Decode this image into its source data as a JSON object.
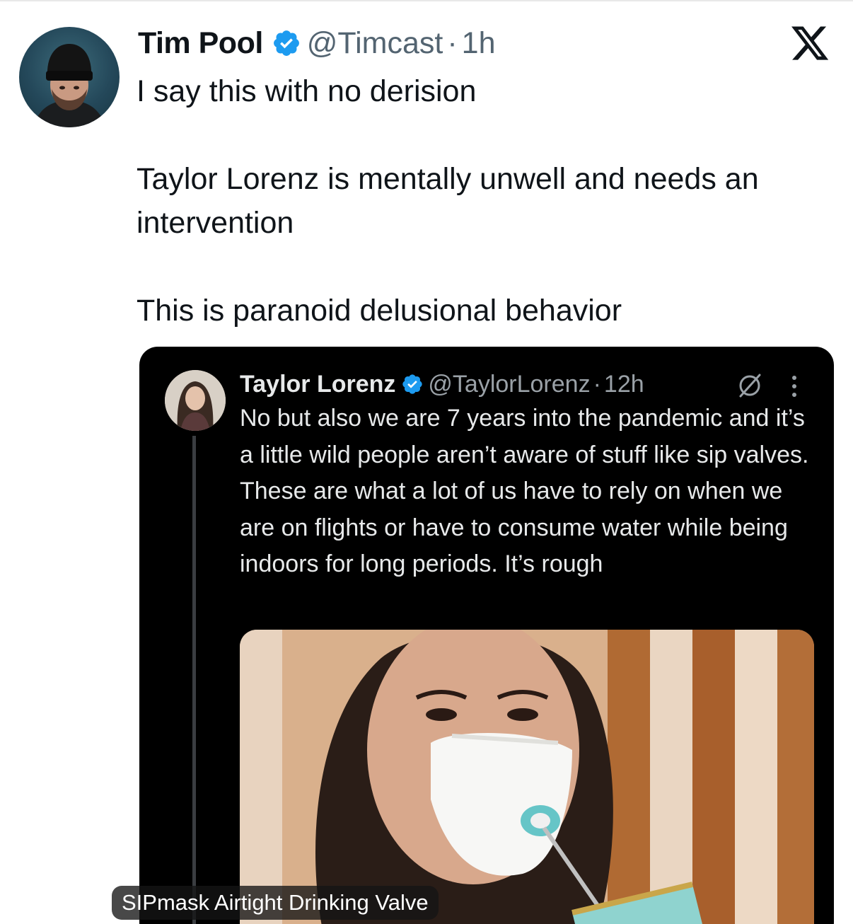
{
  "tweet": {
    "author_name": "Tim Pool",
    "handle": "@Timcast",
    "separator": "·",
    "time": "1h",
    "text_lines": [
      "I say this with no derision",
      "Taylor Lorenz is mentally unwell and needs an intervention",
      "This is paranoid delusional behavior"
    ]
  },
  "quoted": {
    "author_name": "Taylor Lorenz",
    "handle": "@TaylorLorenz",
    "separator": "·",
    "time": "12h",
    "text": "No but also we are 7 years into the pandemic and it’s a little wild people aren’t aware of stuff like sip valves. These are what a lot of us have to rely on when we are on flights or have to consume water while being indoors for long periods. It’s rough",
    "media_caption": "SIPmask Airtight Drinking Valve"
  },
  "colors": {
    "verified_blue": "#1d9bf0",
    "secondary_text": "#536471",
    "dark_card_bg": "#000000"
  },
  "icons": {
    "platform_logo": "x-logo-icon",
    "verified": "verified-badge-icon",
    "grok": "grok-icon",
    "more": "more-options-icon"
  }
}
